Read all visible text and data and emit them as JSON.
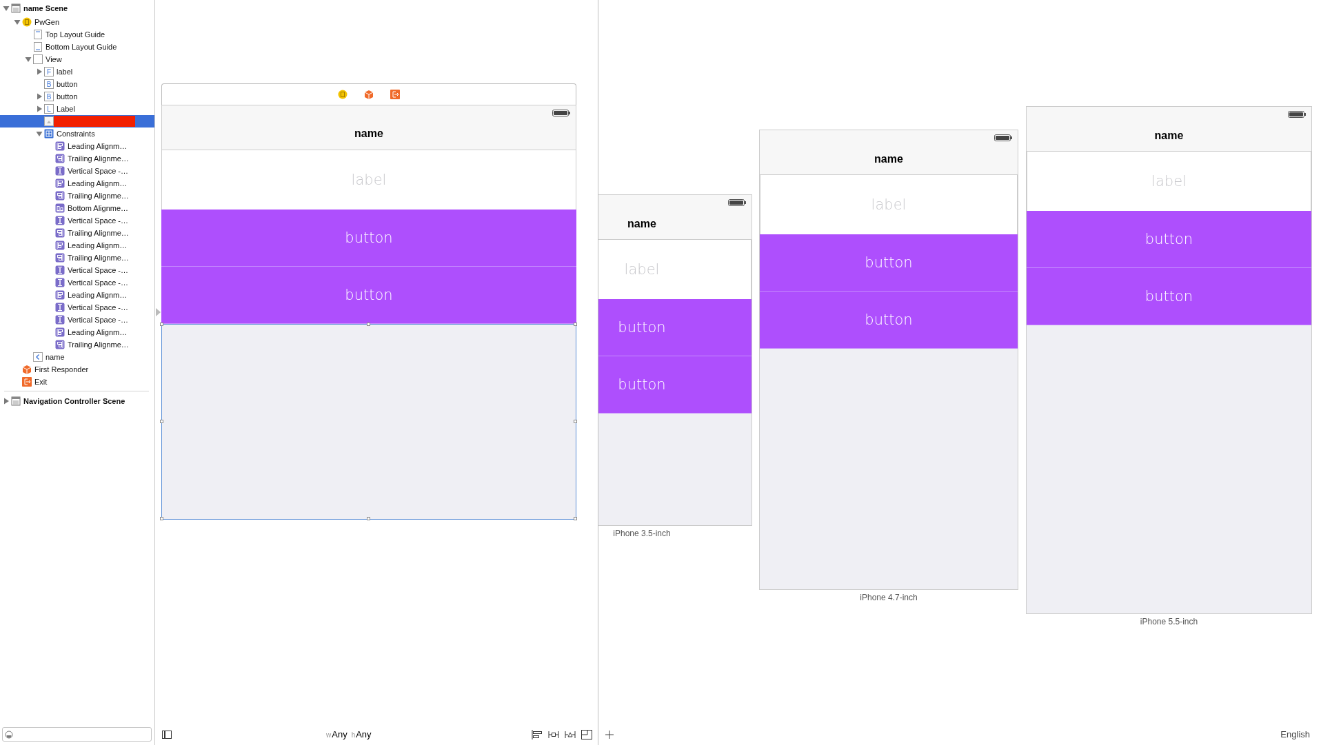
{
  "outline": {
    "items": [
      {
        "label": "name Scene",
        "kind": "scene",
        "expanded": true,
        "selected": false,
        "children": [
          {
            "label": "PwGen",
            "kind": "view_controller",
            "expanded": true,
            "selected": false,
            "children": [
              {
                "label": "Top Layout Guide",
                "kind": "top_guide",
                "selected": false
              },
              {
                "label": "Bottom Layout Guide",
                "kind": "bottom_guide",
                "selected": false
              },
              {
                "label": "View",
                "kind": "view",
                "expanded": true,
                "selected": false,
                "children": [
                  {
                    "label": "label",
                    "kind": "letter",
                    "letter": "F",
                    "expanded": false,
                    "selected": false
                  },
                  {
                    "label": "button",
                    "kind": "letter",
                    "letter": "B",
                    "selected": false
                  },
                  {
                    "label": "button",
                    "kind": "letter",
                    "letter": "B",
                    "expanded": false,
                    "selected": false
                  },
                  {
                    "label": "Label",
                    "kind": "letter",
                    "letter": "L",
                    "expanded": false,
                    "selected": false
                  },
                  {
                    "kind": "image_view",
                    "redacted": true,
                    "selected": true
                  },
                  {
                    "label": "Constraints",
                    "kind": "constraints",
                    "expanded": true,
                    "selected": false,
                    "children": [
                      {
                        "label": "Leading Alignm…",
                        "kind": "leading",
                        "selected": false
                      },
                      {
                        "label": "Trailing Alignme…",
                        "kind": "trailing",
                        "selected": false
                      },
                      {
                        "label": "Vertical Space -…",
                        "kind": "vertical",
                        "selected": false
                      },
                      {
                        "label": "Leading Alignm…",
                        "kind": "leading",
                        "selected": false
                      },
                      {
                        "label": "Trailing Alignme…",
                        "kind": "trailing",
                        "selected": false
                      },
                      {
                        "label": "Bottom Alignme…",
                        "kind": "bottom",
                        "selected": false
                      },
                      {
                        "label": "Vertical Space -…",
                        "kind": "vertical",
                        "selected": false
                      },
                      {
                        "label": "Trailing Alignme…",
                        "kind": "trailing",
                        "selected": false
                      },
                      {
                        "label": "Leading Alignm…",
                        "kind": "leading",
                        "selected": false
                      },
                      {
                        "label": "Trailing Alignme…",
                        "kind": "trailing",
                        "selected": false
                      },
                      {
                        "label": "Vertical Space -…",
                        "kind": "vertical",
                        "selected": false
                      },
                      {
                        "label": "Vertical Space -…",
                        "kind": "vertical",
                        "selected": false
                      },
                      {
                        "label": "Leading Alignm…",
                        "kind": "leading",
                        "selected": false
                      },
                      {
                        "label": "Vertical Space -…",
                        "kind": "vertical",
                        "selected": false
                      },
                      {
                        "label": "Vertical Space -…",
                        "kind": "vertical",
                        "selected": false
                      },
                      {
                        "label": "Leading Alignm…",
                        "kind": "leading",
                        "selected": false
                      },
                      {
                        "label": "Trailing Alignme…",
                        "kind": "trailing",
                        "selected": false
                      }
                    ]
                  }
                ]
              },
              {
                "label": "name",
                "kind": "nav_item",
                "selected": false
              }
            ]
          },
          {
            "label": "First Responder",
            "kind": "first_responder",
            "selected": false
          },
          {
            "label": "Exit",
            "kind": "exit",
            "selected": false
          }
        ]
      },
      {
        "label": "Navigation Controller Scene",
        "kind": "scene",
        "expanded": false,
        "selected": false
      }
    ]
  },
  "scene": {
    "dock": [
      {
        "kind": "view_controller"
      },
      {
        "kind": "first_responder"
      },
      {
        "kind": "exit"
      }
    ],
    "nav_title": "name",
    "rows": [
      {
        "kind": "label",
        "text": "label"
      },
      {
        "kind": "button",
        "text": "button"
      },
      {
        "kind": "button",
        "text": "button"
      }
    ],
    "content_view": {
      "selected": true
    }
  },
  "previews": [
    {
      "device": "iPhone 3.5-inch",
      "nav_title": "name",
      "rows": [
        {
          "kind": "label",
          "text": "label"
        },
        {
          "kind": "button",
          "text": "button"
        },
        {
          "kind": "button",
          "text": "button"
        }
      ]
    },
    {
      "device": "iPhone 4.7-inch",
      "nav_title": "name",
      "rows": [
        {
          "kind": "label",
          "text": "label"
        },
        {
          "kind": "button",
          "text": "button"
        },
        {
          "kind": "button",
          "text": "button"
        }
      ]
    },
    {
      "device": "iPhone 5.5-inch",
      "nav_title": "name",
      "rows": [
        {
          "kind": "label",
          "text": "label"
        },
        {
          "kind": "button",
          "text": "button"
        },
        {
          "kind": "button",
          "text": "button"
        }
      ]
    }
  ],
  "size_class": [
    {
      "prefix": "w",
      "value": "Any"
    },
    {
      "prefix": "h",
      "value": "Any"
    }
  ],
  "language": "English"
}
